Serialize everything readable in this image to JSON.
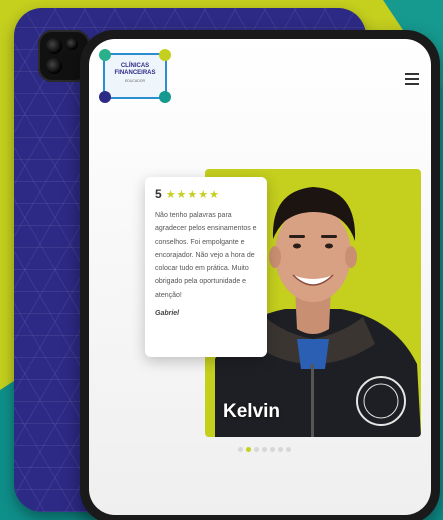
{
  "brand": {
    "logo_title": "CLÍNICAS\nFINANCEIRAS",
    "logo_subtitle": "EDUCADOR",
    "colors": {
      "yellow": "#c4cf1e",
      "teal": "#16998f",
      "purple": "#2d2a86"
    }
  },
  "header": {
    "menu_icon": "hamburger-icon"
  },
  "testimonial": {
    "rating": "5",
    "stars": "★★★★★",
    "text": "Não tenho palavras para agradecer pelos ensinamentos e conselhos. Foi empolgante e encorajador. Não vejo a hora de colocar tudo em prática. Muito obrigado pela oportunidade e atenção!",
    "author": "Gabriel"
  },
  "featured": {
    "name": "Kelvin",
    "shirt_badge": "CLÍNICAS FINANCEIRAS"
  },
  "carousel": {
    "total": 7,
    "active_index": 1
  }
}
